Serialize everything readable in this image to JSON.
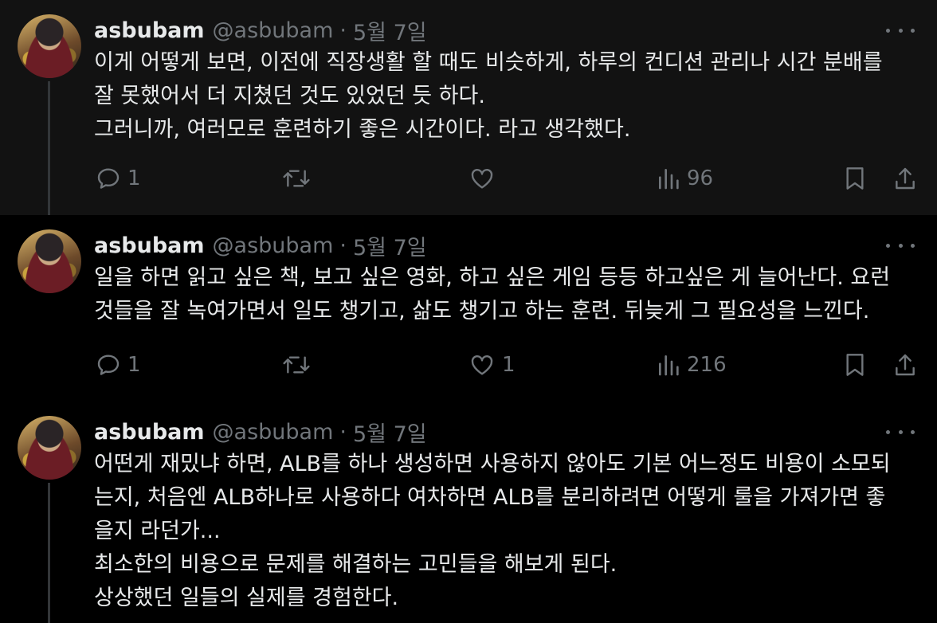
{
  "tweets": [
    {
      "name": "asbubam",
      "handle": "@asbubam",
      "separator": "·",
      "date": "5월 7일",
      "lines": [
        "이게 어떻게 보면, 이전에 직장생활 할 때도 비슷하게, 하루의 컨디션 관리나 시간 분배를",
        "잘 못했어서 더 지쳤던 것도 있었던 듯 하다.",
        "그러니까, 여러모로 훈련하기 좋은 시간이다. 라고 생각했다."
      ],
      "replies": "1",
      "reposts": "",
      "likes": "",
      "views": "96"
    },
    {
      "name": "asbubam",
      "handle": "@asbubam",
      "separator": "·",
      "date": "5월 7일",
      "lines": [
        "일을 하면 읽고 싶은 책, 보고 싶은 영화, 하고 싶은 게임 등등 하고싶은 게 늘어난다. 요런",
        "것들을 잘 녹여가면서 일도 챙기고, 삶도 챙기고 하는 훈련. 뒤늦게 그 필요성을 느낀다."
      ],
      "replies": "1",
      "reposts": "",
      "likes": "1",
      "views": "216"
    },
    {
      "name": "asbubam",
      "handle": "@asbubam",
      "separator": "·",
      "date": "5월 7일",
      "lines": [
        "어떤게 재밌냐 하면, ALB를 하나 생성하면 사용하지 않아도 기본 어느정도 비용이 소모되",
        "는지, 처음엔 ALB하나로 사용하다 여차하면 ALB를 분리하려면 어떻게 룰을 가져가면 좋",
        "을지 라던가...",
        "최소한의 비용으로 문제를 해결하는 고민들을 해보게 된다.",
        "상상했던 일들의 실제를 경험한다."
      ]
    }
  ],
  "icons": {
    "reply": "reply-icon",
    "repost": "repost-icon",
    "like": "like-icon",
    "views": "views-icon",
    "bookmark": "bookmark-icon",
    "share": "share-icon",
    "more": "more-icon"
  },
  "colors": {
    "background": "#000000",
    "highlight_background": "#121212",
    "text": "#e7e9ea",
    "muted": "#71767b",
    "thread_line": "#333639"
  }
}
